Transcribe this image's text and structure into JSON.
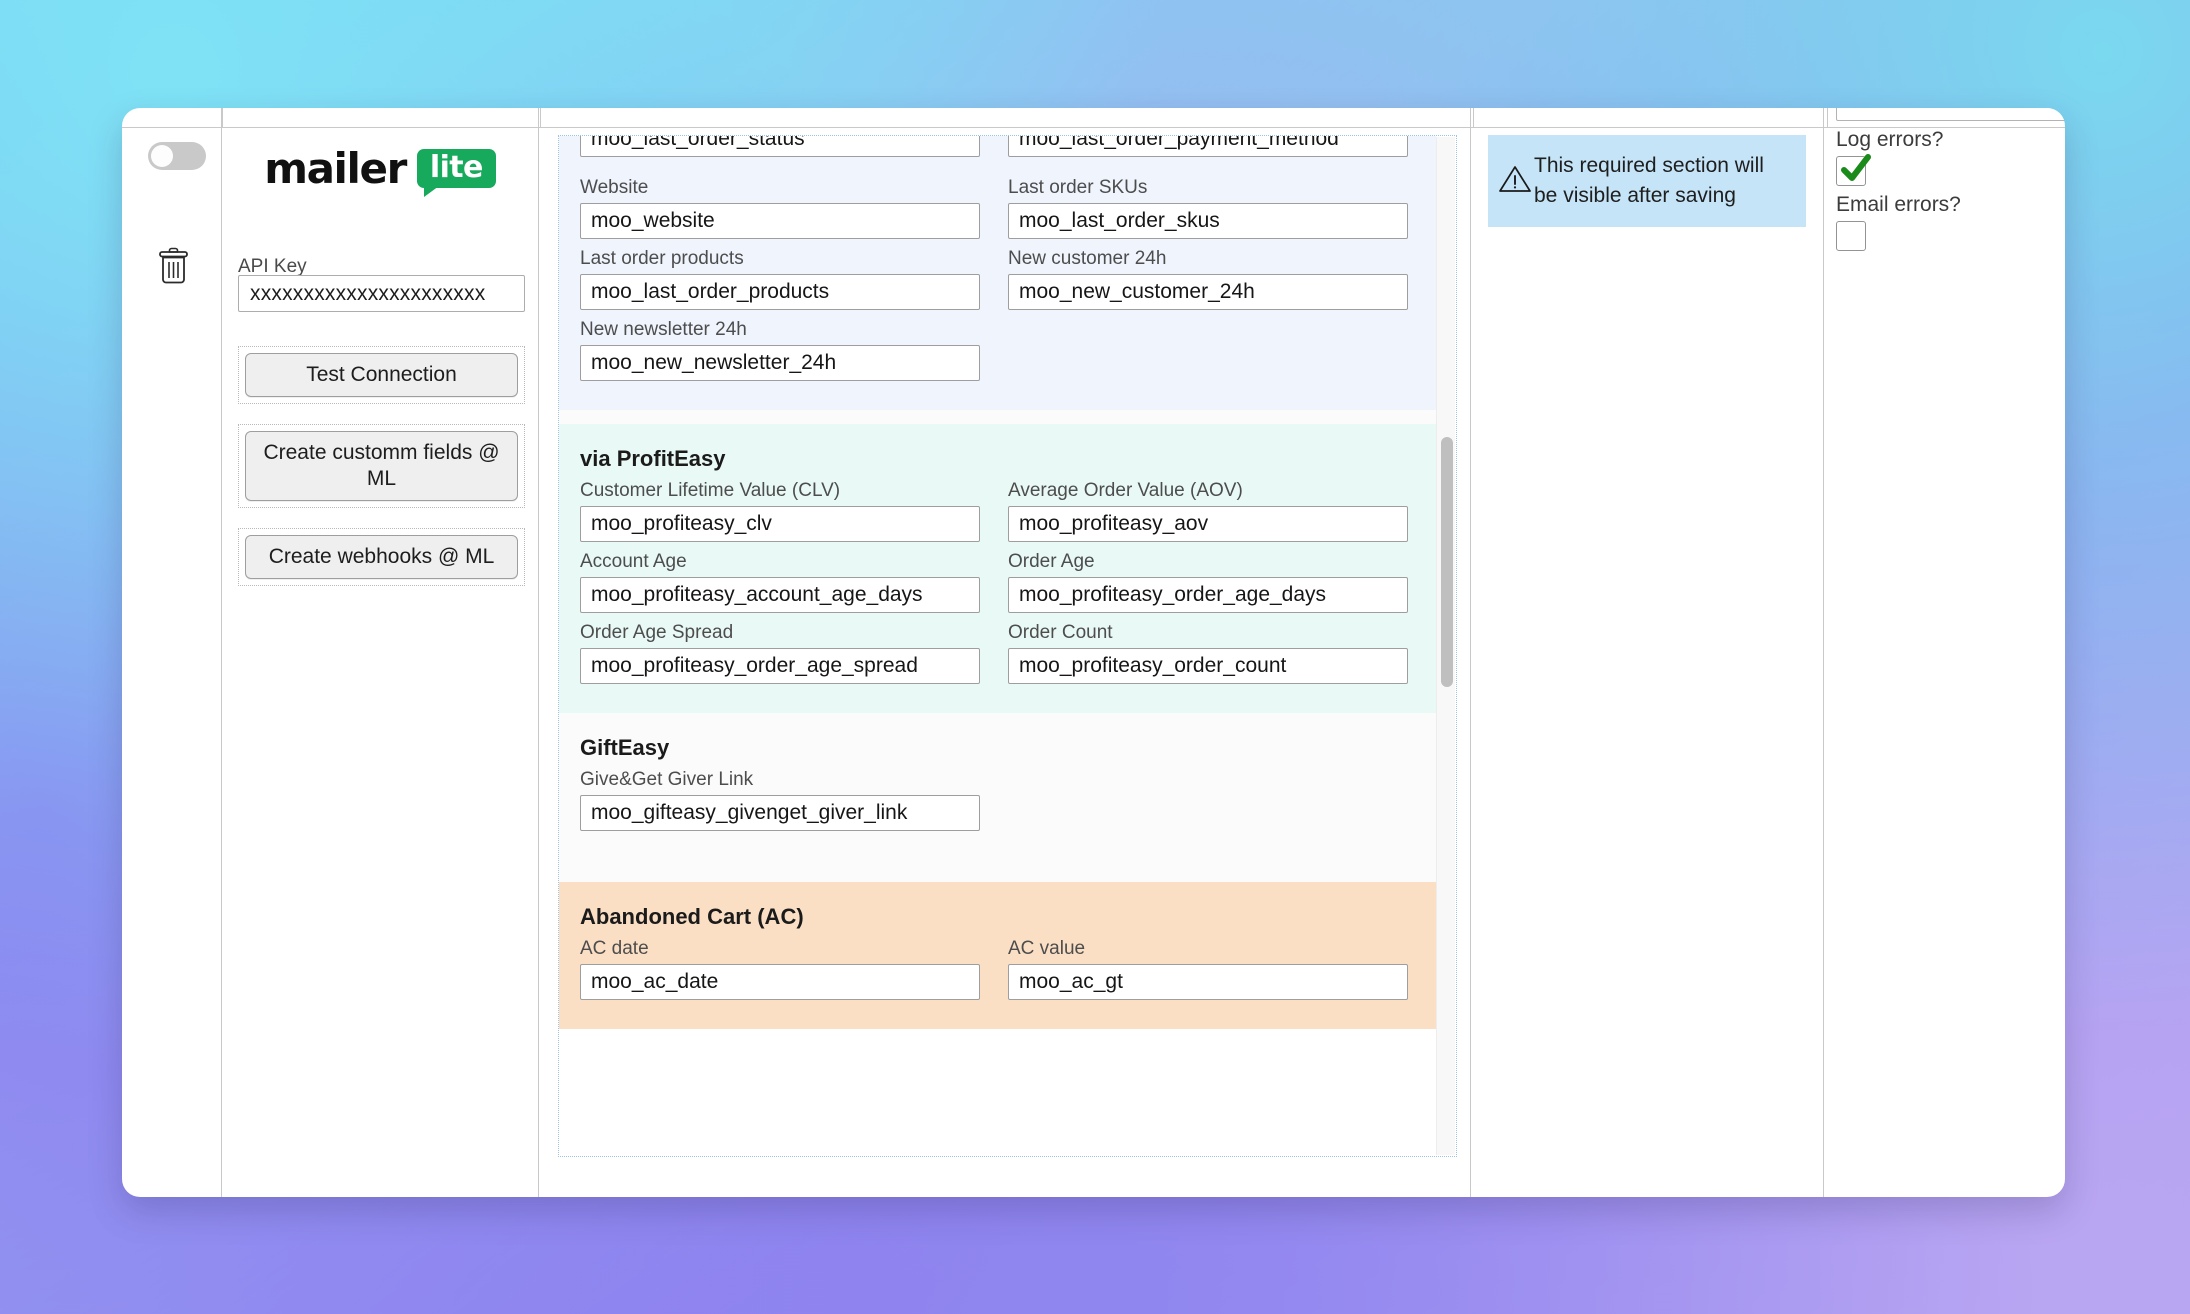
{
  "window": {
    "toggle_state": "off",
    "delete_icon": "trash-icon"
  },
  "sidebar": {
    "logo_text": "mailer",
    "logo_badge": "lite",
    "api_key": {
      "label": "API Key",
      "value": "xxxxxxxxxxxxxxxxxxxxxx"
    },
    "buttons": [
      {
        "label": "Test Connection"
      },
      {
        "label": "Create customm fields @ ML"
      },
      {
        "label": "Create webhooks @ ML"
      }
    ]
  },
  "main": {
    "clipped_top_row": [
      {
        "value": "moo_last_order_status"
      },
      {
        "value": "moo_last_order_payment_method"
      }
    ],
    "sections": [
      {
        "id": "shop-data",
        "title": "",
        "theme": "blue",
        "fields": [
          {
            "label": "Website",
            "value": "moo_website"
          },
          {
            "label": "Last order SKUs",
            "value": "moo_last_order_skus"
          },
          {
            "label": "Last order products",
            "value": "moo_last_order_products"
          },
          {
            "label": "New customer 24h",
            "value": "moo_new_customer_24h"
          },
          {
            "label": "New newsletter 24h",
            "value": "moo_new_newsletter_24h"
          }
        ]
      },
      {
        "id": "profiteasy",
        "title": "via ProfitEasy",
        "theme": "mint",
        "fields": [
          {
            "label": "Customer Lifetime Value (CLV)",
            "value": "moo_profiteasy_clv"
          },
          {
            "label": "Average Order Value (AOV)",
            "value": "moo_profiteasy_aov"
          },
          {
            "label": "Account Age",
            "value": "moo_profiteasy_account_age_days"
          },
          {
            "label": "Order Age",
            "value": "moo_profiteasy_order_age_days"
          },
          {
            "label": "Order Age Spread",
            "value": "moo_profiteasy_order_age_spread"
          },
          {
            "label": "Order Count",
            "value": "moo_profiteasy_order_count"
          }
        ]
      },
      {
        "id": "gifteasy",
        "title": "GiftEasy",
        "theme": "white",
        "fields": [
          {
            "label": "Give&Get Giver Link",
            "value": "moo_gifteasy_givenget_giver_link"
          }
        ]
      },
      {
        "id": "abandoned-cart",
        "title": "Abandoned Cart (AC)",
        "theme": "peach",
        "fields": [
          {
            "label": "AC date",
            "value": "moo_ac_date"
          },
          {
            "label": "AC value",
            "value": "moo_ac_gt"
          }
        ]
      }
    ]
  },
  "notice": {
    "icon": "warning-triangle-icon",
    "text": "This required section will be visible after saving",
    "bg_color": "#c5e4f7"
  },
  "options": {
    "log_errors": {
      "label": "Log errors?",
      "checked": true,
      "check_color": "#1a8a1a"
    },
    "email_errors": {
      "label": "Email errors?",
      "checked": false
    }
  }
}
